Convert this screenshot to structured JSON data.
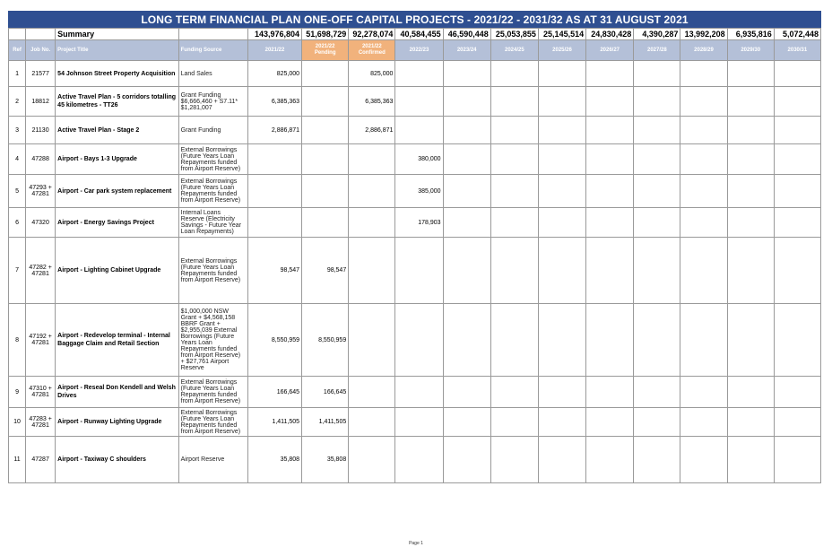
{
  "title": "LONG TERM FINANCIAL PLAN ONE-OFF CAPITAL PROJECTS - 2021/22 - 2031/32 AS AT 31 AUGUST 2021",
  "summary": {
    "label": "Summary",
    "values": [
      "143,976,804",
      "51,698,729",
      "92,278,074",
      "40,584,455",
      "46,590,448",
      "25,053,855",
      "25,145,514",
      "24,830,428",
      "4,390,287",
      "13,992,208",
      "6,935,816",
      "5,072,448"
    ]
  },
  "headers": {
    "ref": "Ref",
    "job": "Job No.",
    "title": "Project Title",
    "funding": "Funding Source",
    "years": [
      {
        "line1": "2021/22",
        "line2": ""
      },
      {
        "line1": "2021/22",
        "line2": "Pending"
      },
      {
        "line1": "2021/22",
        "line2": "Confirmed"
      },
      {
        "line1": "2022/23",
        "line2": ""
      },
      {
        "line1": "2023/24",
        "line2": ""
      },
      {
        "line1": "2024/25",
        "line2": ""
      },
      {
        "line1": "2025/26",
        "line2": ""
      },
      {
        "line1": "2026/27",
        "line2": ""
      },
      {
        "line1": "2027/28",
        "line2": ""
      },
      {
        "line1": "2028/29",
        "line2": ""
      },
      {
        "line1": "2029/30",
        "line2": ""
      },
      {
        "line1": "2030/31",
        "line2": ""
      }
    ]
  },
  "rows": [
    {
      "ref": "1",
      "job": "21577",
      "title": "54 Johnson Street Property Acquisition",
      "funding": "Land Sales",
      "values": [
        "825,000",
        "",
        "825,000",
        "",
        "",
        "",
        "",
        "",
        "",
        "",
        "",
        ""
      ]
    },
    {
      "ref": "2",
      "job": "18812",
      "title": "Active Travel Plan - 5 corridors totalling 45 kilometres - TT26",
      "funding": "Grant Funding $6,666,460 + S7.11* $1,281,007",
      "values": [
        "6,385,363",
        "",
        "6,385,363",
        "",
        "",
        "",
        "",
        "",
        "",
        "",
        "",
        ""
      ]
    },
    {
      "ref": "3",
      "job": "21130",
      "title": "Active Travel Plan - Stage 2",
      "funding": "Grant Funding",
      "values": [
        "2,886,871",
        "",
        "2,886,871",
        "",
        "",
        "",
        "",
        "",
        "",
        "",
        "",
        ""
      ]
    },
    {
      "ref": "4",
      "job": "47288",
      "title": "Airport - Bays 1-3 Upgrade",
      "funding": "External Borrowings (Future Years Loan Repayments funded from Airport Reserve)",
      "values": [
        "",
        "",
        "",
        "380,000",
        "",
        "",
        "",
        "",
        "",
        "",
        "",
        ""
      ]
    },
    {
      "ref": "5",
      "job": "47293 + 47281",
      "title": "Airport - Car park system replacement",
      "funding": "External Borrowings (Future Years Loan Repayments funded from Airport Reserve)",
      "values": [
        "",
        "",
        "",
        "385,000",
        "",
        "",
        "",
        "",
        "",
        "",
        "",
        ""
      ]
    },
    {
      "ref": "6",
      "job": "47320",
      "title": "Airport - Energy Savings Project",
      "funding": "Internal Loans Reserve (Electricity Savings - Future Year Loan Repayments)",
      "values": [
        "",
        "",
        "",
        "178,903",
        "",
        "",
        "",
        "",
        "",
        "",
        "",
        ""
      ]
    },
    {
      "ref": "7",
      "job": "47282 + 47281",
      "title": "Airport - Lighting Cabinet Upgrade",
      "funding": "External Borrowings (Future Years Loan Repayments funded from Airport Reserve)",
      "values": [
        "98,547",
        "98,547",
        "",
        "",
        "",
        "",
        "",
        "",
        "",
        "",
        "",
        ""
      ]
    },
    {
      "ref": "8",
      "job": "47192 + 47281",
      "title": "Airport - Redevelop terminal - Internal Baggage Claim and Retail Section",
      "funding": "$1,000,000 NSW Grant + $4,568,158 BBRF Grant + $2,955,039 External Borrowings (Future Years Loan Repayments funded from Airport Reserve) + $27,761 Airport Reserve",
      "values": [
        "8,550,959",
        "8,550,959",
        "",
        "",
        "",
        "",
        "",
        "",
        "",
        "",
        "",
        ""
      ]
    },
    {
      "ref": "9",
      "job": "47310 + 47281",
      "title": "Airport - Reseal Don Kendell and Welsh Drives",
      "funding": "External Borrowings (Future Years Loan Repayments funded from Airport Reserve)",
      "values": [
        "166,645",
        "166,645",
        "",
        "",
        "",
        "",
        "",
        "",
        "",
        "",
        "",
        ""
      ]
    },
    {
      "ref": "10",
      "job": "47283 + 47281",
      "title": "Airport - Runway Lighting Upgrade",
      "funding": "External Borrowings (Future Years Loan Repayments funded from Airport Reserve)",
      "values": [
        "1,411,505",
        "1,411,505",
        "",
        "",
        "",
        "",
        "",
        "",
        "",
        "",
        "",
        ""
      ]
    },
    {
      "ref": "11",
      "job": "47287",
      "title": "Airport - Taxiway C shoulders",
      "funding": "Airport Reserve",
      "values": [
        "35,808",
        "35,808",
        "",
        "",
        "",
        "",
        "",
        "",
        "",
        "",
        "",
        ""
      ]
    }
  ],
  "footer": "Page 1",
  "colors": {
    "title_bg": "#2f4f91",
    "header_bg": "#b4c0d8",
    "pending_bg": "#f1b27c"
  }
}
